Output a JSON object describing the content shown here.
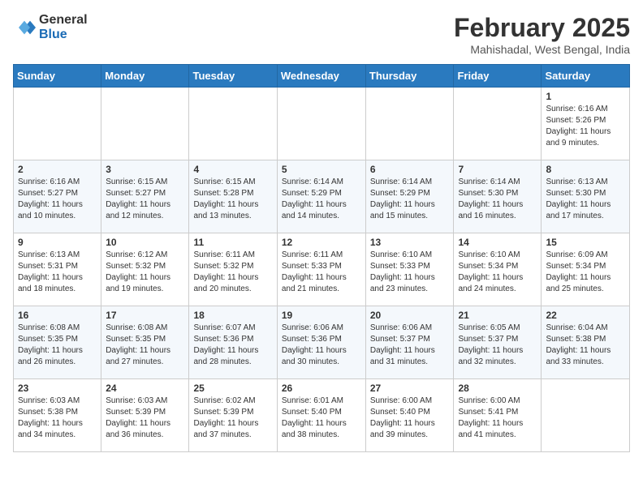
{
  "header": {
    "logo_general": "General",
    "logo_blue": "Blue",
    "title": "February 2025",
    "subtitle": "Mahishadal, West Bengal, India"
  },
  "weekdays": [
    "Sunday",
    "Monday",
    "Tuesday",
    "Wednesday",
    "Thursday",
    "Friday",
    "Saturday"
  ],
  "weeks": [
    [
      {
        "day": "",
        "info": ""
      },
      {
        "day": "",
        "info": ""
      },
      {
        "day": "",
        "info": ""
      },
      {
        "day": "",
        "info": ""
      },
      {
        "day": "",
        "info": ""
      },
      {
        "day": "",
        "info": ""
      },
      {
        "day": "1",
        "info": "Sunrise: 6:16 AM\nSunset: 5:26 PM\nDaylight: 11 hours\nand 9 minutes."
      }
    ],
    [
      {
        "day": "2",
        "info": "Sunrise: 6:16 AM\nSunset: 5:27 PM\nDaylight: 11 hours\nand 10 minutes."
      },
      {
        "day": "3",
        "info": "Sunrise: 6:15 AM\nSunset: 5:27 PM\nDaylight: 11 hours\nand 12 minutes."
      },
      {
        "day": "4",
        "info": "Sunrise: 6:15 AM\nSunset: 5:28 PM\nDaylight: 11 hours\nand 13 minutes."
      },
      {
        "day": "5",
        "info": "Sunrise: 6:14 AM\nSunset: 5:29 PM\nDaylight: 11 hours\nand 14 minutes."
      },
      {
        "day": "6",
        "info": "Sunrise: 6:14 AM\nSunset: 5:29 PM\nDaylight: 11 hours\nand 15 minutes."
      },
      {
        "day": "7",
        "info": "Sunrise: 6:14 AM\nSunset: 5:30 PM\nDaylight: 11 hours\nand 16 minutes."
      },
      {
        "day": "8",
        "info": "Sunrise: 6:13 AM\nSunset: 5:30 PM\nDaylight: 11 hours\nand 17 minutes."
      }
    ],
    [
      {
        "day": "9",
        "info": "Sunrise: 6:13 AM\nSunset: 5:31 PM\nDaylight: 11 hours\nand 18 minutes."
      },
      {
        "day": "10",
        "info": "Sunrise: 6:12 AM\nSunset: 5:32 PM\nDaylight: 11 hours\nand 19 minutes."
      },
      {
        "day": "11",
        "info": "Sunrise: 6:11 AM\nSunset: 5:32 PM\nDaylight: 11 hours\nand 20 minutes."
      },
      {
        "day": "12",
        "info": "Sunrise: 6:11 AM\nSunset: 5:33 PM\nDaylight: 11 hours\nand 21 minutes."
      },
      {
        "day": "13",
        "info": "Sunrise: 6:10 AM\nSunset: 5:33 PM\nDaylight: 11 hours\nand 23 minutes."
      },
      {
        "day": "14",
        "info": "Sunrise: 6:10 AM\nSunset: 5:34 PM\nDaylight: 11 hours\nand 24 minutes."
      },
      {
        "day": "15",
        "info": "Sunrise: 6:09 AM\nSunset: 5:34 PM\nDaylight: 11 hours\nand 25 minutes."
      }
    ],
    [
      {
        "day": "16",
        "info": "Sunrise: 6:08 AM\nSunset: 5:35 PM\nDaylight: 11 hours\nand 26 minutes."
      },
      {
        "day": "17",
        "info": "Sunrise: 6:08 AM\nSunset: 5:35 PM\nDaylight: 11 hours\nand 27 minutes."
      },
      {
        "day": "18",
        "info": "Sunrise: 6:07 AM\nSunset: 5:36 PM\nDaylight: 11 hours\nand 28 minutes."
      },
      {
        "day": "19",
        "info": "Sunrise: 6:06 AM\nSunset: 5:36 PM\nDaylight: 11 hours\nand 30 minutes."
      },
      {
        "day": "20",
        "info": "Sunrise: 6:06 AM\nSunset: 5:37 PM\nDaylight: 11 hours\nand 31 minutes."
      },
      {
        "day": "21",
        "info": "Sunrise: 6:05 AM\nSunset: 5:37 PM\nDaylight: 11 hours\nand 32 minutes."
      },
      {
        "day": "22",
        "info": "Sunrise: 6:04 AM\nSunset: 5:38 PM\nDaylight: 11 hours\nand 33 minutes."
      }
    ],
    [
      {
        "day": "23",
        "info": "Sunrise: 6:03 AM\nSunset: 5:38 PM\nDaylight: 11 hours\nand 34 minutes."
      },
      {
        "day": "24",
        "info": "Sunrise: 6:03 AM\nSunset: 5:39 PM\nDaylight: 11 hours\nand 36 minutes."
      },
      {
        "day": "25",
        "info": "Sunrise: 6:02 AM\nSunset: 5:39 PM\nDaylight: 11 hours\nand 37 minutes."
      },
      {
        "day": "26",
        "info": "Sunrise: 6:01 AM\nSunset: 5:40 PM\nDaylight: 11 hours\nand 38 minutes."
      },
      {
        "day": "27",
        "info": "Sunrise: 6:00 AM\nSunset: 5:40 PM\nDaylight: 11 hours\nand 39 minutes."
      },
      {
        "day": "28",
        "info": "Sunrise: 6:00 AM\nSunset: 5:41 PM\nDaylight: 11 hours\nand 41 minutes."
      },
      {
        "day": "",
        "info": ""
      }
    ]
  ]
}
